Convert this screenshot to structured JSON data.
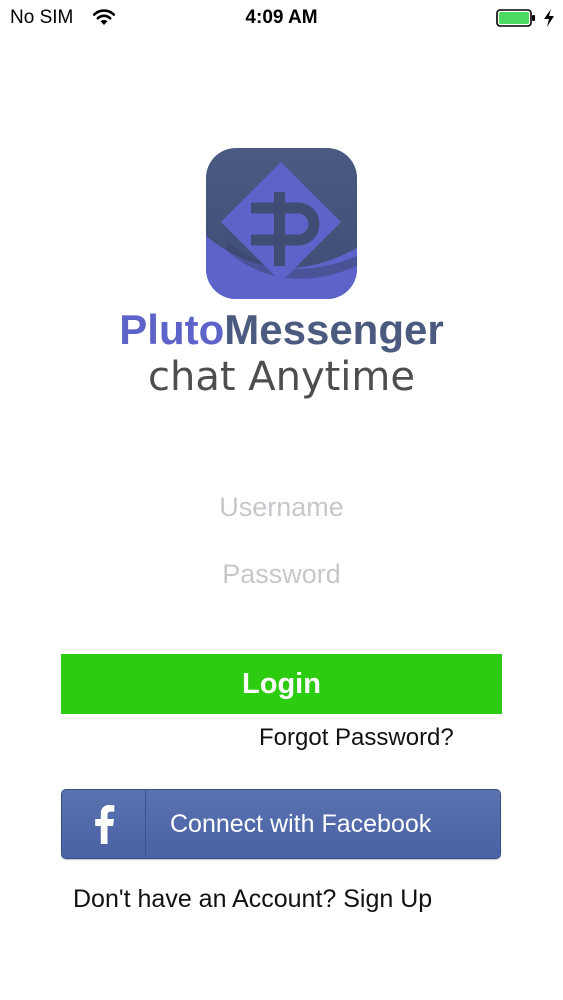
{
  "status_bar": {
    "carrier": "No SIM",
    "time": "4:09 AM",
    "battery_color": "#4cd964"
  },
  "branding": {
    "name_part1": "Pluto",
    "name_part2": "Messenger",
    "tagline": "chat Anytime",
    "icon": "pluto-messenger-logo-icon",
    "colors": {
      "primary": "#5d63c9",
      "secondary": "#4b5a7e"
    }
  },
  "form": {
    "username_placeholder": "Username",
    "password_placeholder": "Password",
    "username_value": "",
    "password_value": ""
  },
  "actions": {
    "login_label": "Login",
    "login_color": "#2ecc10",
    "forgot_label": "Forgot Password?",
    "facebook_label": "Connect with Facebook",
    "facebook_color": "#4a62a3",
    "signup_label": "Don't have an Account? Sign Up"
  }
}
